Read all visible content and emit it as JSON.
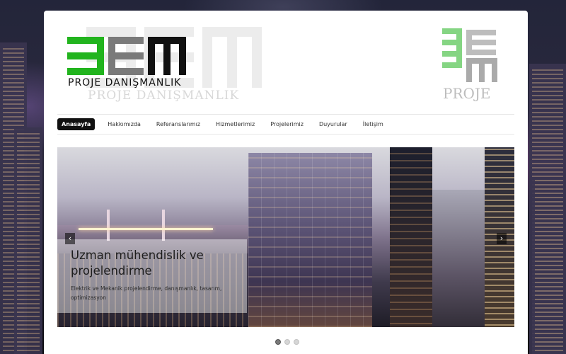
{
  "brand": {
    "logo_text": "PROJE DANIŞMANLIK",
    "ghost_text": "PROJE DANIŞMANLIK",
    "mini_logo_text": "PROJE",
    "colors": {
      "green": "#22b41e",
      "gray": "#7a7a7a",
      "black": "#111111",
      "mini_green": "#8ee08a"
    }
  },
  "nav": {
    "items": [
      {
        "label": "Anasayfa",
        "active": true
      },
      {
        "label": "Hakkımızda",
        "active": false
      },
      {
        "label": "Referanslarımız",
        "active": false
      },
      {
        "label": "Hizmetlerimiz",
        "active": false
      },
      {
        "label": "Projelerimiz",
        "active": false
      },
      {
        "label": "Duyurular",
        "active": false
      },
      {
        "label": "İletişim",
        "active": false
      }
    ]
  },
  "slider": {
    "caption_title": "Uzman mühendislik ve projelendirme",
    "caption_text": "Elektrik ve Mekanik projelendirme, danışmanlık, tasarım, optimizasyon",
    "prev_icon": "chevron-left-icon",
    "next_icon": "chevron-right-icon",
    "prev_glyph": "‹",
    "next_glyph": "›",
    "slide_count": 3,
    "active_slide": 1
  }
}
